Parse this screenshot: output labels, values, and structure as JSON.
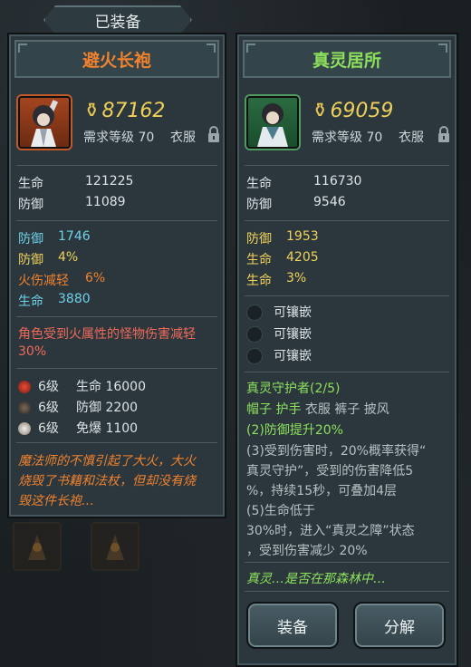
{
  "equipped_tab": "已装备",
  "left": {
    "title": "避火长袍",
    "power": "87162",
    "required_level": "需求等级 70",
    "slot": "衣服",
    "base_stats": [
      {
        "label": "生命",
        "value": "121225"
      },
      {
        "label": "防御",
        "value": "11089"
      }
    ],
    "bonus_stats": [
      {
        "label": "防御",
        "value": "1746",
        "color": "#6fd2e8"
      },
      {
        "label": "防御",
        "value": "4%",
        "color": "#f0d25a"
      },
      {
        "label": "火伤减轻",
        "value": "6%",
        "color": "#f0822e"
      },
      {
        "label": "生命",
        "value": "3880",
        "color": "#6fd2e8"
      }
    ],
    "special_line1": "角色受到火属性的怪物伤害减轻",
    "special_line2": "30%",
    "gems": [
      {
        "level": "6级",
        "stat": "生命 16000",
        "icon": "red-gem-icon"
      },
      {
        "level": "6级",
        "stat": "防御 2200",
        "icon": "dark-gem-icon"
      },
      {
        "level": "6级",
        "stat": "免爆 1100",
        "icon": "skull-gem-icon"
      }
    ],
    "lore": [
      "魔法师的不慎引起了大火，大火",
      "烧毁了书籍和法杖，但却没有烧",
      "毁这件长袍…"
    ]
  },
  "right": {
    "title": "真灵居所",
    "power": "69059",
    "required_level": "需求等级 70",
    "slot": "衣服",
    "base_stats": [
      {
        "label": "生命",
        "value": "116730"
      },
      {
        "label": "防御",
        "value": "9546"
      }
    ],
    "bonus_stats": [
      {
        "label": "防御",
        "value": "1953"
      },
      {
        "label": "生命",
        "value": "4205"
      },
      {
        "label": "生命",
        "value": "3%"
      }
    ],
    "sockets": [
      "可镶嵌",
      "可镶嵌",
      "可镶嵌"
    ],
    "set_title": "真灵守护者(2/5)",
    "set_pieces_owned": "帽子 护手",
    "set_pieces_missing": "衣服 裤子 披风",
    "set_bonus_active": "(2)防御提升20%",
    "set_bonus_3": [
      "(3)受到伤害时，20%概率获得“",
      "真灵守护”，受到的伤害降低5",
      "%，持续15秒，可叠加4层"
    ],
    "set_bonus_5": [
      "(5)生命低于",
      "30%时，进入“真灵之障”状态",
      "，受到伤害减少 20%"
    ],
    "lore": "真灵…是否在那森林中…",
    "equip_button": "装备",
    "dismantle_button": "分解"
  }
}
